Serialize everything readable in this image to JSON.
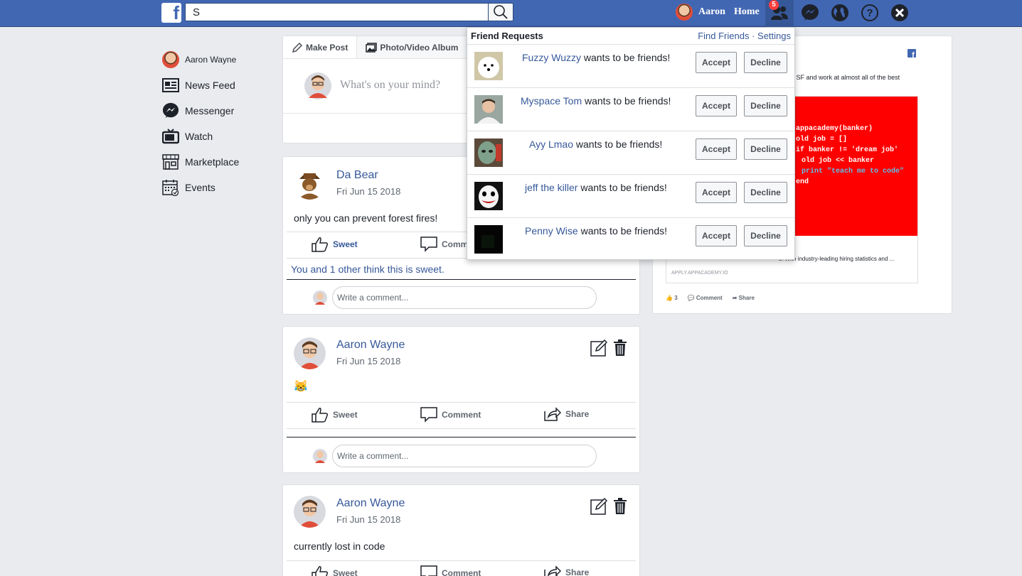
{
  "topbar": {
    "search_value": "S",
    "user_name": "Aaron",
    "home_label": "Home",
    "friend_request_count": "5"
  },
  "sidebar": {
    "items": [
      {
        "label": "Aaron Wayne",
        "icon": "avatar"
      },
      {
        "label": "News Feed",
        "icon": "news-feed-icon"
      },
      {
        "label": "Messenger",
        "icon": "messenger-icon"
      },
      {
        "label": "Watch",
        "icon": "tv-icon"
      },
      {
        "label": "Marketplace",
        "icon": "store-icon"
      },
      {
        "label": "Events",
        "icon": "calendar-icon"
      }
    ]
  },
  "composer": {
    "tabs": [
      "Make Post",
      "Photo/Video Album"
    ],
    "placeholder": "What's on your mind?"
  },
  "posts": [
    {
      "author": "Da Bear",
      "date": "Fri Jun 15 2018",
      "body": "only you can prevent forest fires!",
      "actions": {
        "like": "Sweet",
        "comment": "Comment"
      },
      "likes_text": "You and 1 other think this is sweet.",
      "comment_placeholder": "Write a comment..."
    },
    {
      "author": "Aaron Wayne",
      "date": "Fri Jun 15 2018",
      "body": "😹",
      "actions": {
        "like": "Sweet",
        "comment": "Comment",
        "share": "Share"
      },
      "comment_placeholder": "Write a comment..."
    },
    {
      "author": "Aaron Wayne",
      "date": "Fri Jun 15 2018",
      "body": "currently lost in code",
      "actions": {
        "like": "Sweet",
        "comment": "Comment",
        "share": "Share"
      }
    }
  ],
  "friend_requests": {
    "title": "Friend Requests",
    "links": "Find Friends · Settings",
    "suffix": "wants to be friends!",
    "accept_label": "Accept",
    "decline_label": "Decline",
    "items": [
      {
        "name": "Fuzzy Wuzzy"
      },
      {
        "name": "Myspace Tom"
      },
      {
        "name": "Ayy Lmao"
      },
      {
        "name": "jeff the killer"
      },
      {
        "name": "Penny Wise"
      }
    ]
  },
  "ad": {
    "text": "n SF and work at almost all of the best",
    "code_lines": [
      "appacademy(banker)",
      "old job = []",
      "if banker != 'dream job'",
      "old job << banker",
      "print \"teach me to code\"",
      "end"
    ],
    "caption": "s. With industry-leading hiring statistics and ...",
    "url": "APPLY.APPACADEMY.IO",
    "likes": "3",
    "comment": "Comment",
    "share": "Share"
  },
  "colors": {
    "brand": "#4267b2",
    "link": "#365899",
    "badge": "#fa3e3e",
    "ad_red": "#ff0000"
  }
}
